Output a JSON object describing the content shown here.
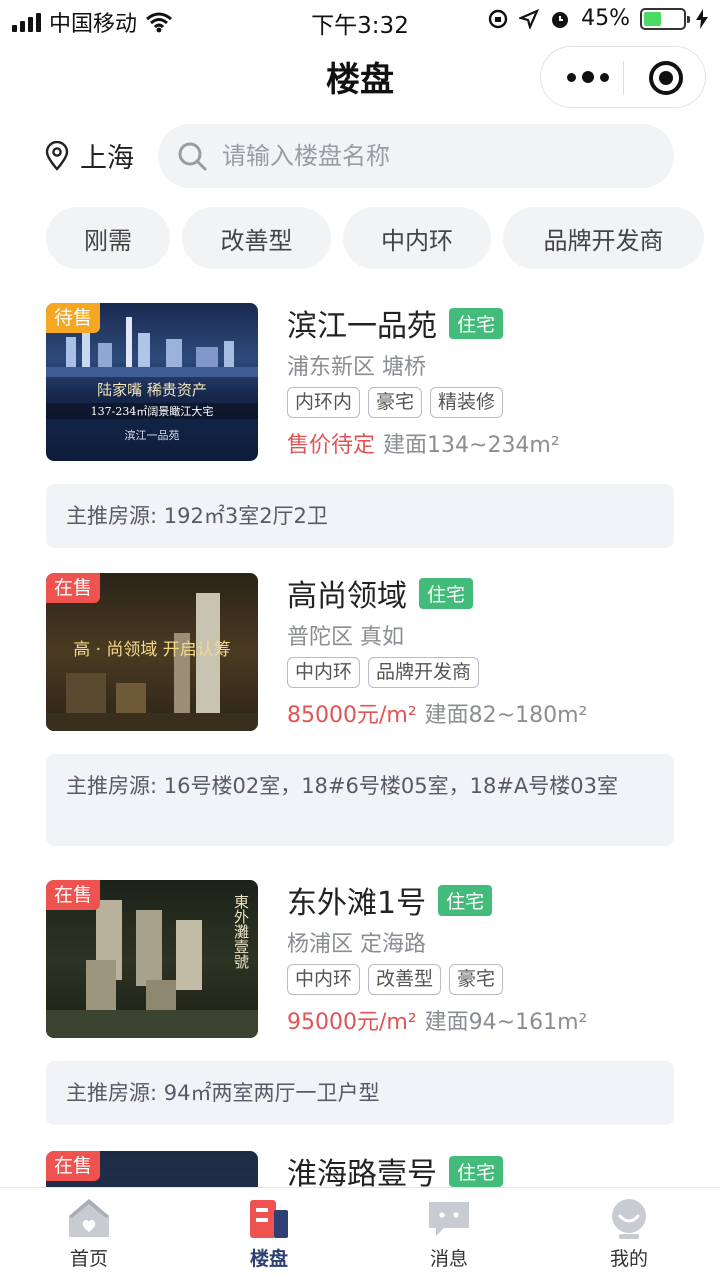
{
  "status_bar": {
    "carrier": "中国移动",
    "time": "下午3:32",
    "battery": "45%",
    "battery_level": 0.45
  },
  "nav": {
    "title": "楼盘"
  },
  "search": {
    "city": "上海",
    "placeholder": "请输入楼盘名称"
  },
  "filters": [
    "刚需",
    "改善型",
    "中内环",
    "品牌开发商"
  ],
  "listings": [
    {
      "status": "待售",
      "name": "滨江一品苑",
      "type": "住宅",
      "district": "浦东新区 塘桥",
      "tags": [
        "内环内",
        "豪宅",
        "精装修"
      ],
      "price": "售价待定",
      "area": "建面134~234m²",
      "recommend": "主推房源: 192㎡3室2厅2卫",
      "image_text": [
        "陆家嘴 稀贵资产",
        "137-234㎡阔景瞰江大宅",
        "滨江一品苑"
      ]
    },
    {
      "status": "在售",
      "name": "高尚领域",
      "type": "住宅",
      "district": "普陀区 真如",
      "tags": [
        "中内环",
        "品牌开发商"
      ],
      "price": "85000元/m²",
      "area": "建面82~180m²",
      "recommend": "主推房源: 16号楼02室，18#6号楼05室，18#A号楼03室",
      "image_text": [
        "高 · 尚领域 开启认筹"
      ]
    },
    {
      "status": "在售",
      "name": "东外滩1号",
      "type": "住宅",
      "district": "杨浦区 定海路",
      "tags": [
        "中内环",
        "改善型",
        "豪宅"
      ],
      "price": "95000元/m²",
      "area": "建面94~161m²",
      "recommend": "主推房源: 94㎡两室两厅一卫户型",
      "image_text": [
        "東外灘壹號"
      ]
    },
    {
      "status": "在售",
      "name": "淮海路壹号",
      "type": "住宅"
    }
  ],
  "tabbar": [
    {
      "label": "首页",
      "icon": "home-icon"
    },
    {
      "label": "楼盘",
      "icon": "building-icon",
      "active": true
    },
    {
      "label": "消息",
      "icon": "chat-icon"
    },
    {
      "label": "我的",
      "icon": "profile-icon"
    }
  ],
  "colors": {
    "accent": "#2f3f73",
    "residential_tag": "#43bb7b",
    "price": "#e15454",
    "pending_badge": "#f5a623",
    "onsale_badge": "#ef5350"
  }
}
